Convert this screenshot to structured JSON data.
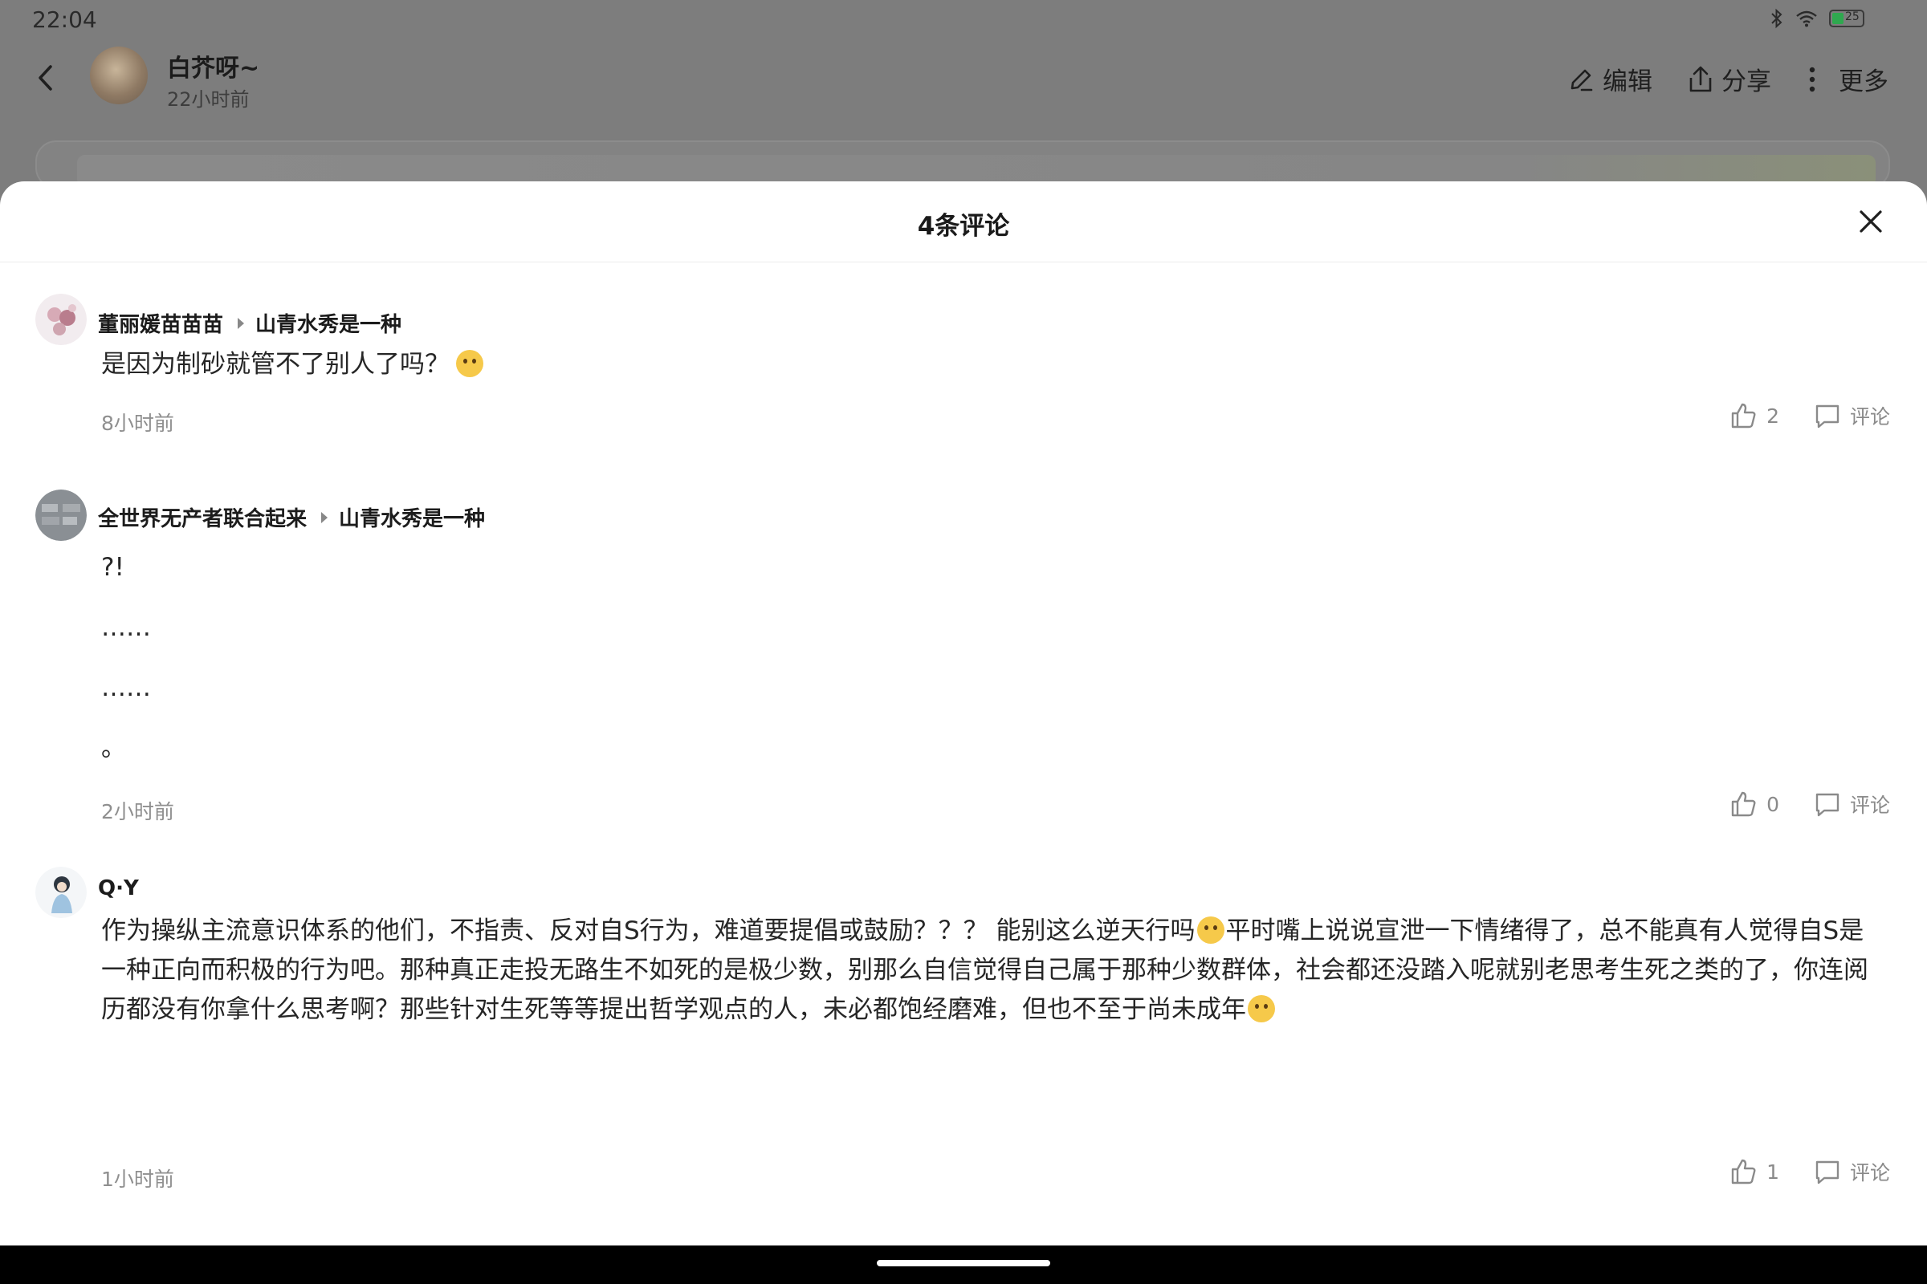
{
  "status_bar": {
    "time": "22:04",
    "battery_level": "25"
  },
  "post_header": {
    "author_name": "白芥呀~",
    "author_time": "22小时前",
    "actions": {
      "edit": "编辑",
      "share": "分享",
      "more": "更多"
    }
  },
  "comment_sheet": {
    "title": "4条评论",
    "comments": [
      {
        "author": "董丽媛苗苗苗",
        "reply_to": "山青水秀是一种",
        "lines": [
          "是因为制砂就管不了别人了吗？"
        ],
        "emoji": "pleading-face",
        "time": "8小时前",
        "likes": "2",
        "comment_label": "评论"
      },
      {
        "author": "全世界无产者联合起来",
        "reply_to": "山青水秀是一种",
        "lines": [
          "?!",
          "……",
          "……",
          "。"
        ],
        "time": "2小时前",
        "likes": "0",
        "comment_label": "评论"
      },
      {
        "author": "Q·Y",
        "reply_to": "",
        "lines": [
          "作为操纵主流意识体系的他们，不指责、反对自S行为，难道要提倡或鼓励？？？ 能别这么逆天行吗",
          "平时嘴上说说宣泄一下情绪得了，总不能真有人觉得自S是一种正向而积极的行为吧。那种真正走投无路生不如死的是极少数，别那么自信觉得自己属于那种少数群体，社会都还没踏入呢就别老思考生死之类的了，你连阅历都没有你拿什么思考啊？那些针对生死等等提出哲学观点的人，未必都饱经磨难，但也不至于尚未成年"
        ],
        "emoji": "face-with-tears-of-joy",
        "time": "1小时前",
        "likes": "1",
        "comment_label": "评论"
      }
    ]
  },
  "colors": {
    "accent_text": "#1a1a1a",
    "meta_text": "#8f8f8f",
    "scrim": "#7d7d7d"
  },
  "icons": [
    "back-icon",
    "edit-icon",
    "share-icon",
    "more-icon",
    "close-icon",
    "thumbs-up-icon",
    "comment-icon",
    "bluetooth-icon",
    "wifi-icon",
    "battery-icon"
  ]
}
